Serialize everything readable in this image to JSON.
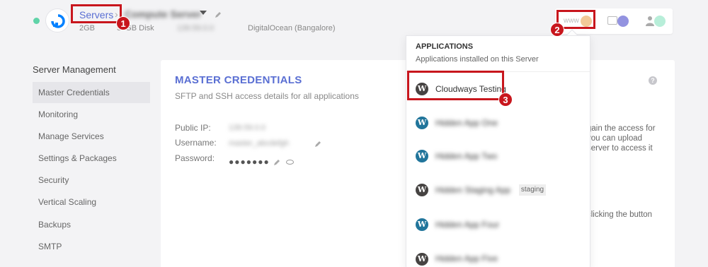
{
  "header": {
    "breadcrumb_root": "Servers",
    "server_name": "Compute Server",
    "ram": "2GB",
    "disk": "50GB Disk",
    "ip": "139.59.0.0",
    "provider": "DigitalOcean (Bangalore)"
  },
  "toolbar": {
    "www_label": "www"
  },
  "annotations": {
    "badge1": "1",
    "badge2": "2",
    "badge3": "3"
  },
  "sidebar": {
    "title": "Server Management",
    "items": [
      {
        "label": "Master Credentials",
        "active": true
      },
      {
        "label": "Monitoring"
      },
      {
        "label": "Manage Services"
      },
      {
        "label": "Settings & Packages"
      },
      {
        "label": "Security"
      },
      {
        "label": "Vertical Scaling"
      },
      {
        "label": "Backups"
      },
      {
        "label": "SMTP"
      }
    ]
  },
  "main": {
    "title": "MASTER CREDENTIALS",
    "subtitle": "SFTP and SSH access details for all applications",
    "help": "?",
    "public_ip_label": "Public IP:",
    "public_ip_value": "139.59.0.0",
    "username_label": "Username:",
    "username_value": "master_abcdefgh",
    "password_label": "Password:",
    "password_mask": "●●●●●●●",
    "side_text": [
      "gain the access for",
      "you can upload",
      "server to access it",
      "clicking the button"
    ]
  },
  "dropdown": {
    "title": "APPLICATIONS",
    "subtitle": "Applications installed on this Server",
    "apps": [
      {
        "name": "Cloudways Testing",
        "icon": "wordpress-icon",
        "color": "#464342",
        "blurred": false,
        "tag": ""
      },
      {
        "name": "Hidden App One",
        "icon": "wordpress-icon",
        "color": "#21759b",
        "blurred": true,
        "tag": ""
      },
      {
        "name": "Hidden App Two",
        "icon": "wordpress-icon",
        "color": "#21759b",
        "blurred": true,
        "tag": ""
      },
      {
        "name": "Hidden Staging App",
        "icon": "wordpress-icon",
        "color": "#464342",
        "blurred": true,
        "tag": "staging"
      },
      {
        "name": "Hidden App Four",
        "icon": "wordpress-icon",
        "color": "#21759b",
        "blurred": true,
        "tag": ""
      },
      {
        "name": "Hidden App Five",
        "icon": "wordpress-icon",
        "color": "#464342",
        "blurred": true,
        "tag": ""
      }
    ]
  },
  "colors": {
    "accent": "#5a6fd3",
    "annotation": "#c8161d",
    "status": "#5fd3a8"
  }
}
